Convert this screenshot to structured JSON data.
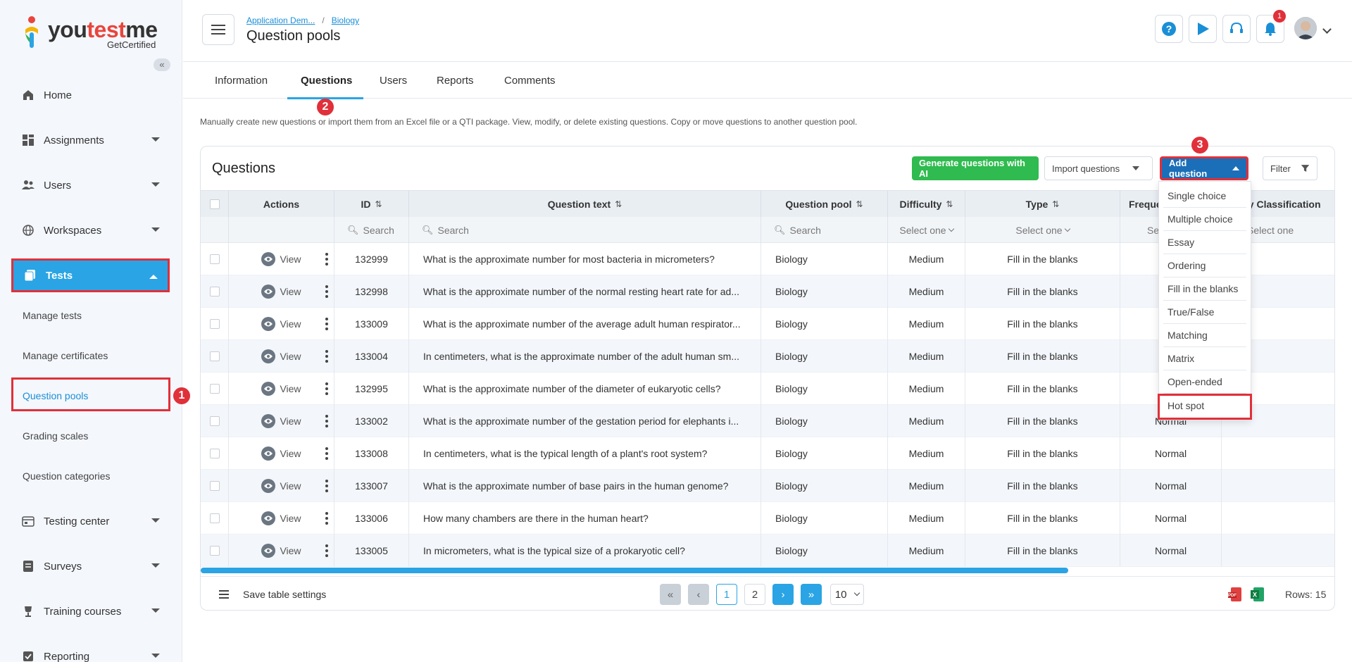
{
  "logo": {
    "brand_you": "you",
    "brand_test": "test",
    "brand_me": "me",
    "tagline": "GetCertified"
  },
  "sidebar": {
    "items": [
      {
        "label": "Home",
        "icon": "home-icon"
      },
      {
        "label": "Assignments",
        "icon": "assignments-icon"
      },
      {
        "label": "Users",
        "icon": "users-icon"
      },
      {
        "label": "Workspaces",
        "icon": "globe-icon"
      },
      {
        "label": "Tests",
        "icon": "tests-icon"
      },
      {
        "label": "Testing center",
        "icon": "testing-center-icon"
      },
      {
        "label": "Surveys",
        "icon": "surveys-icon"
      },
      {
        "label": "Training courses",
        "icon": "trophy-icon"
      },
      {
        "label": "Reporting",
        "icon": "reporting-icon"
      }
    ],
    "subitems": [
      "Manage tests",
      "Manage certificates",
      "Question pools",
      "Grading scales",
      "Question categories"
    ]
  },
  "markers": [
    "1",
    "2",
    "3"
  ],
  "header": {
    "breadcrumb": [
      "Application Dem...",
      "Biology"
    ],
    "breadcrumb_sep": "/",
    "title": "Question pools",
    "notification_count": "1"
  },
  "tabs": [
    "Information",
    "Questions",
    "Users",
    "Reports",
    "Comments"
  ],
  "description": "Manually create new questions or import them from an Excel file or a QTI package. View, modify, or delete existing questions. Copy or move questions to another question pool.",
  "card": {
    "title": "Questions",
    "generate_btn": "Generate questions with AI",
    "import_btn": "Import questions",
    "add_btn": "Add question",
    "filter_btn": "Filter"
  },
  "table": {
    "headers": [
      "Actions",
      "ID",
      "Question text",
      "Question pool",
      "Difficulty",
      "Type",
      "Freque",
      "nary Classification"
    ],
    "sort_icon": "⇅",
    "filter_search": "Search",
    "filter_select": "Select one",
    "filter_select_short": "Se",
    "view_label": "View",
    "rows": [
      {
        "id": "132999",
        "text": "What is the approximate number for most bacteria in micrometers?",
        "pool": "Biology",
        "difficulty": "Medium",
        "type": "Fill in the blanks",
        "freq": ""
      },
      {
        "id": "132998",
        "text": "What is the approximate number of the normal resting heart rate for ad...",
        "pool": "Biology",
        "difficulty": "Medium",
        "type": "Fill in the blanks",
        "freq": ""
      },
      {
        "id": "133009",
        "text": "What is the approximate number of the average adult human respirator...",
        "pool": "Biology",
        "difficulty": "Medium",
        "type": "Fill in the blanks",
        "freq": ""
      },
      {
        "id": "133004",
        "text": "In centimeters, what is the approximate number of the adult human sm...",
        "pool": "Biology",
        "difficulty": "Medium",
        "type": "Fill in the blanks",
        "freq": ""
      },
      {
        "id": "132995",
        "text": "What is the approximate number of the diameter of eukaryotic cells?",
        "pool": "Biology",
        "difficulty": "Medium",
        "type": "Fill in the blanks",
        "freq": ""
      },
      {
        "id": "133002",
        "text": "What is the approximate number of the gestation period for elephants i...",
        "pool": "Biology",
        "difficulty": "Medium",
        "type": "Fill in the blanks",
        "freq": "Normal"
      },
      {
        "id": "133008",
        "text": "In centimeters, what is the typical length of a plant's root system?",
        "pool": "Biology",
        "difficulty": "Medium",
        "type": "Fill in the blanks",
        "freq": "Normal"
      },
      {
        "id": "133007",
        "text": "What is the approximate number of base pairs in the human genome?",
        "pool": "Biology",
        "difficulty": "Medium",
        "type": "Fill in the blanks",
        "freq": "Normal"
      },
      {
        "id": "133006",
        "text": "How many chambers are there in the human heart?",
        "pool": "Biology",
        "difficulty": "Medium",
        "type": "Fill in the blanks",
        "freq": "Normal"
      },
      {
        "id": "133005",
        "text": "In micrometers, what is the typical size of a prokaryotic cell?",
        "pool": "Biology",
        "difficulty": "Medium",
        "type": "Fill in the blanks",
        "freq": "Normal"
      }
    ]
  },
  "footer": {
    "save_settings": "Save table settings",
    "pages": [
      "1",
      "2"
    ],
    "page_size": "10",
    "rows_label": "Rows: 15"
  },
  "dropdown": [
    "Single choice",
    "Multiple choice",
    "Essay",
    "Ordering",
    "Fill in the blanks",
    "True/False",
    "Matching",
    "Matrix",
    "Open-ended",
    "Hot spot"
  ],
  "colors": {
    "accent": "#2aa4e4",
    "highlight": "#e0303a",
    "add_btn": "#1a6fb8",
    "ai_btn": "#2fbb4f"
  }
}
